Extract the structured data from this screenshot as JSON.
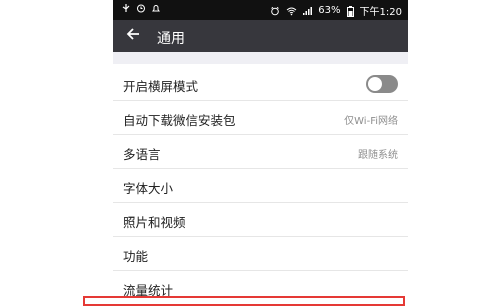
{
  "status_bar": {
    "battery": "63%",
    "time": "下午1:20",
    "left_icons": [
      "usb-icon",
      "timer-icon",
      "notification-icon"
    ],
    "right_icons": [
      "alarm-icon",
      "wifi-icon",
      "signal-icon",
      "battery-icon"
    ]
  },
  "app_bar": {
    "title": "通用",
    "back_icon": "back-arrow-icon"
  },
  "settings": {
    "items": [
      {
        "label": "开启横屏模式",
        "value": "",
        "control": "toggle",
        "toggle_on": false
      },
      {
        "label": "自动下载微信安装包",
        "value": "仅Wi-Fi网络"
      },
      {
        "label": "多语言",
        "value": "跟随系统"
      },
      {
        "label": "字体大小",
        "value": ""
      },
      {
        "label": "照片和视频",
        "value": ""
      },
      {
        "label": "功能",
        "value": ""
      },
      {
        "label": "流量统计",
        "value": ""
      }
    ]
  },
  "colors": {
    "status_bar": "#111111",
    "app_bar": "#37373d",
    "page_bg": "#efeff4",
    "toggle_off": "#8a8a8a",
    "highlight_border": "#e53935"
  }
}
